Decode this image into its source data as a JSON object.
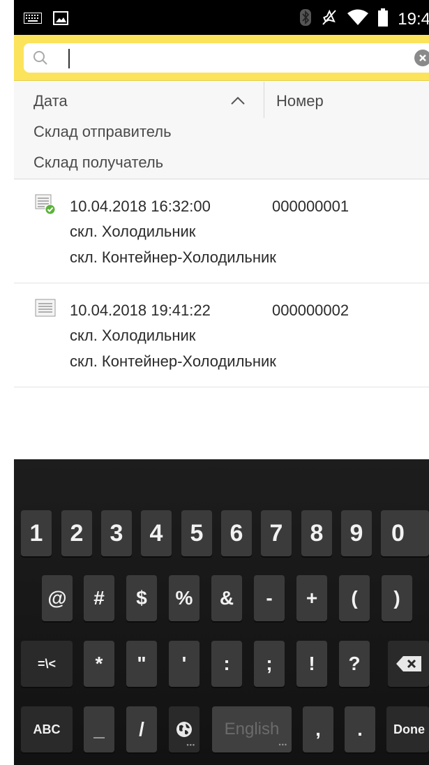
{
  "status_bar": {
    "time": "19:4",
    "icons": [
      "keyboard-icon",
      "image-icon",
      "bluetooth-icon",
      "mute-icon",
      "wifi-icon",
      "battery-icon"
    ]
  },
  "search": {
    "value": "",
    "placeholder": ""
  },
  "table": {
    "header": {
      "date_label": "Дата",
      "number_label": "Номер",
      "sender_label": "Склад отправитель",
      "receiver_label": "Склад получатель",
      "sort_direction": "ascending"
    },
    "rows": [
      {
        "date": "10.04.2018 16:32:00",
        "number": "000000001",
        "sender": "скл. Холодильник",
        "receiver": "скл. Контейнер-Холодильник",
        "status": "posted",
        "icon": "document-posted-icon"
      },
      {
        "date": "10.04.2018 19:41:22",
        "number": "000000002",
        "sender": "скл. Холодильник",
        "receiver": "скл. Контейнер-Холодильник",
        "status": "draft",
        "icon": "document-icon"
      }
    ]
  },
  "keyboard": {
    "row1": [
      "1",
      "2",
      "3",
      "4",
      "5",
      "6",
      "7",
      "8",
      "9",
      "0"
    ],
    "row2": [
      "@",
      "#",
      "$",
      "%",
      "&",
      "-",
      "+",
      "(",
      ")"
    ],
    "row3": [
      "=\\<",
      "*",
      "\"",
      "'",
      ":",
      ";",
      "!",
      "?"
    ],
    "row4": {
      "abc": "ABC",
      "underscore": "_",
      "slash": "/",
      "space": "English",
      "comma": ",",
      "period": ".",
      "done": "Done"
    }
  },
  "colors": {
    "accent_yellow": "#fbe35c",
    "posted_green": "#5ab33a",
    "keyboard_bg": "#1a1a1a",
    "key_bg": "#3b3b3b"
  }
}
